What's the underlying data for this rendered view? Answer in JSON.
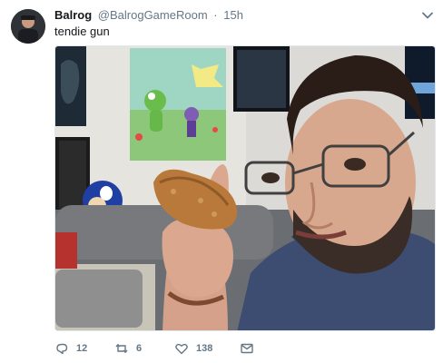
{
  "tweet": {
    "display_name": "Balrog",
    "handle": "@BalrogGameRoom",
    "separator": "·",
    "time": "15h",
    "text": "tendie gun"
  },
  "media": {
    "description": "photo"
  },
  "actions": {
    "reply_count": "12",
    "retweet_count": "6",
    "like_count": "138"
  },
  "colors": {
    "text_primary": "#14171a",
    "text_secondary": "#657786",
    "border": "#e1e8ed"
  },
  "icons": [
    "caret-down-icon",
    "reply-icon",
    "retweet-icon",
    "like-icon",
    "direct-message-icon"
  ]
}
